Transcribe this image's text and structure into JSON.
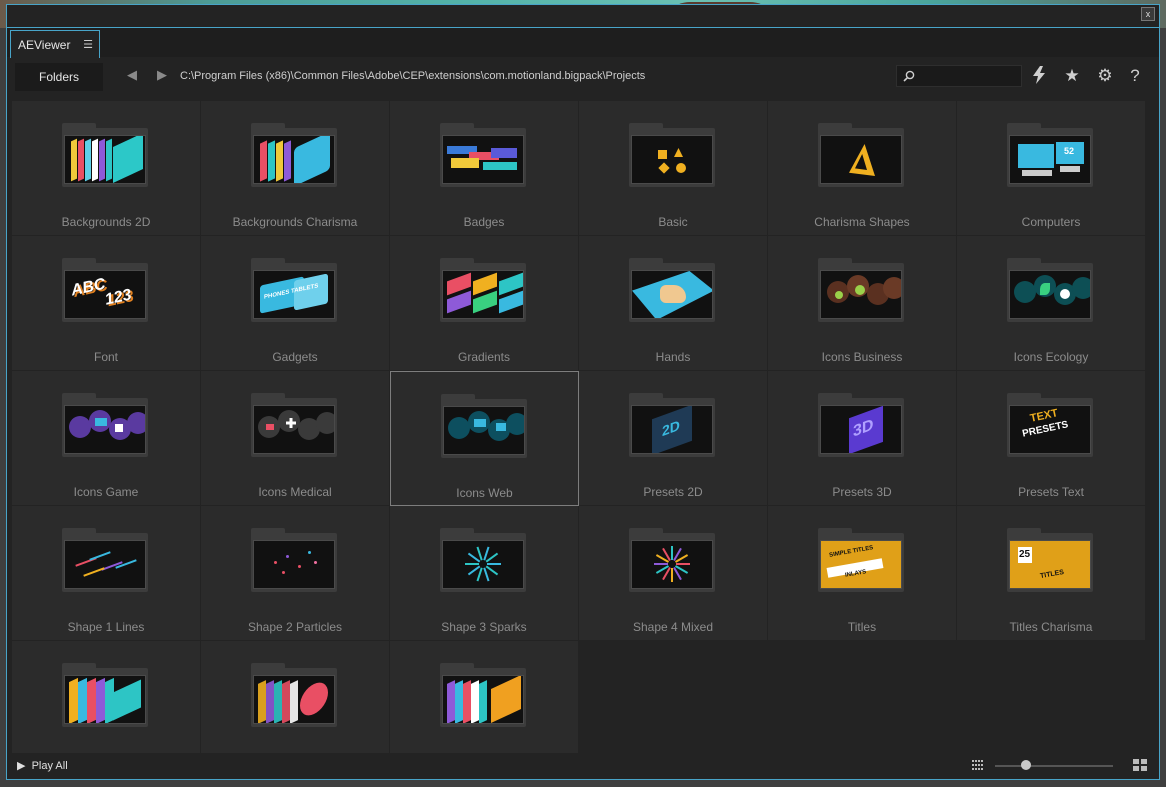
{
  "window": {
    "tab_title": "AEViewer",
    "tab_menu_icon": "hamburger-menu-icon",
    "close_label": "x"
  },
  "toolbar": {
    "folders_label": "Folders",
    "path": "C:\\Program Files (x86)\\Common Files\\Adobe\\CEP\\extensions\\com.motionland.bigpack\\Projects",
    "search_placeholder": "",
    "icons": [
      "search-icon",
      "lightning-icon",
      "star-icon",
      "gear-icon",
      "help-icon"
    ]
  },
  "folders": [
    {
      "label": "Backgrounds 2D",
      "art": "bg2d"
    },
    {
      "label": "Backgrounds Charisma",
      "art": "bgch"
    },
    {
      "label": "Badges",
      "art": "badges"
    },
    {
      "label": "Basic",
      "art": "basic"
    },
    {
      "label": "Charisma Shapes",
      "art": "chshapes"
    },
    {
      "label": "Computers",
      "art": "computers"
    },
    {
      "label": "Font",
      "art": "font"
    },
    {
      "label": "Gadgets",
      "art": "gadgets"
    },
    {
      "label": "Gradients",
      "art": "gradients"
    },
    {
      "label": "Hands",
      "art": "hands"
    },
    {
      "label": "Icons Business",
      "art": "icbiz"
    },
    {
      "label": "Icons Ecology",
      "art": "iceco"
    },
    {
      "label": "Icons Game",
      "art": "icgame"
    },
    {
      "label": "Icons Medical",
      "art": "icmed"
    },
    {
      "label": "Icons Web",
      "art": "icweb",
      "selected": true
    },
    {
      "label": "Presets 2D",
      "art": "pre2d"
    },
    {
      "label": "Presets 3D",
      "art": "pre3d"
    },
    {
      "label": "Presets Text",
      "art": "pretext"
    },
    {
      "label": "Shape 1 Lines",
      "art": "s1"
    },
    {
      "label": "Shape 2 Particles",
      "art": "s2"
    },
    {
      "label": "Shape 3 Sparks",
      "art": "s3"
    },
    {
      "label": "Shape 4 Mixed",
      "art": "s4"
    },
    {
      "label": "Titles",
      "art": "titles"
    },
    {
      "label": "Titles Charisma",
      "art": "titlesch"
    },
    {
      "label": "",
      "art": "t1"
    },
    {
      "label": "",
      "art": "t2"
    },
    {
      "label": "",
      "art": "t3"
    }
  ],
  "thumb_text": {
    "font_line1": "ABC",
    "font_line2": "123",
    "gadgets_sign": "PHONES TABLETS",
    "pre2d": "2D",
    "pre3d": "3D",
    "pretext_line1": "TEXT",
    "pretext_line2": "PRESETS",
    "titles_line1": "SIMPLE TITLES",
    "titles_line2": "INLAYS",
    "titlesch_num": "25",
    "titlesch_line1": "TITLES",
    "computers_screen": "52"
  },
  "statusbar": {
    "play_all_label": "Play All",
    "grid_small_icon": "grid-small-icon",
    "grid_large_icon": "grid-large-icon",
    "zoom_level": 0.26
  },
  "colors": {
    "accent": "#48a4c8",
    "panel": "#2b2b2b",
    "label": "#8c8c8c"
  }
}
